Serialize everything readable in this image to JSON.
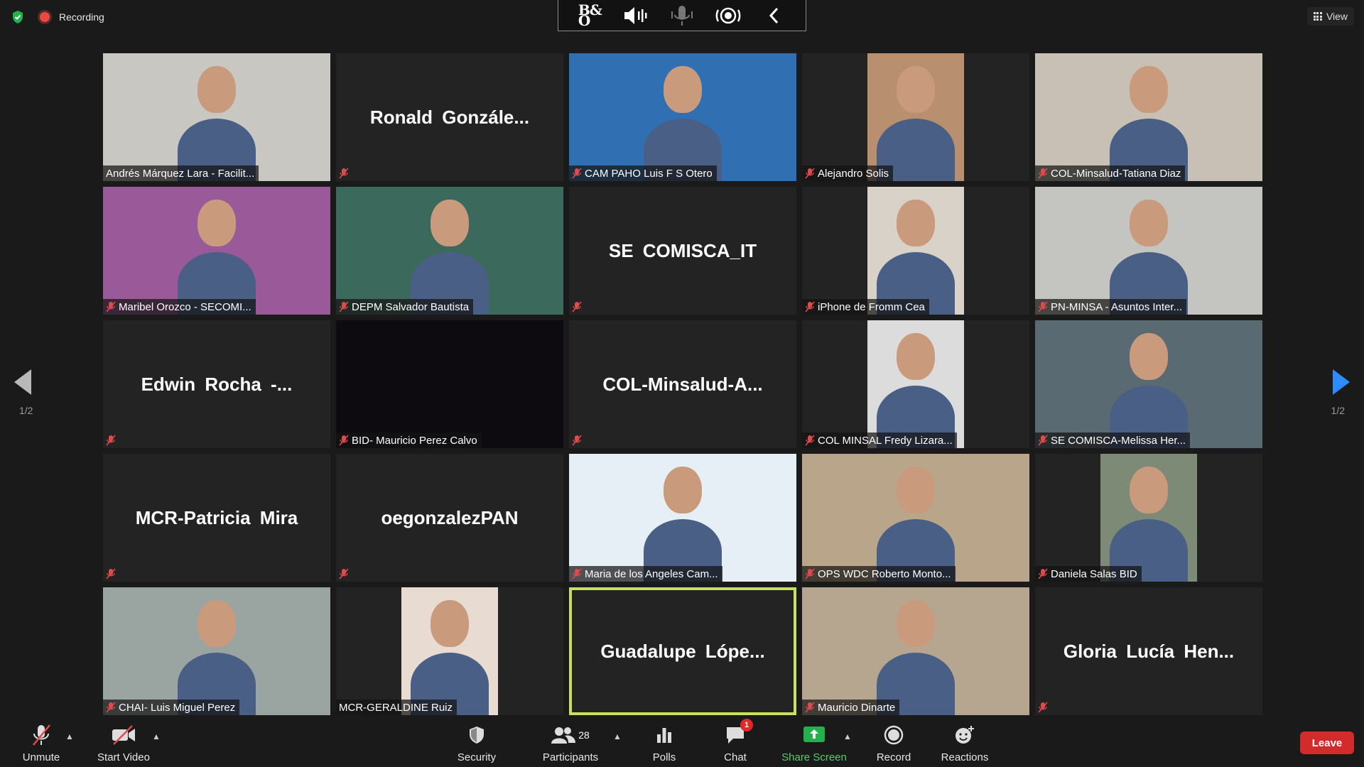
{
  "topbar": {
    "recording_label": "Recording",
    "view_label": "View"
  },
  "pager": {
    "left_page": "1/2",
    "right_page": "1/2"
  },
  "tiles": [
    {
      "name": "Andrés Márquez Lara - Facilit...",
      "mode": "video",
      "muted": false,
      "bg": "#c9c7c2"
    },
    {
      "name": "Ronald  Gonzále...",
      "mode": "text",
      "muted": true
    },
    {
      "name": "CAM PAHO Luis  F S Otero",
      "mode": "video",
      "muted": true,
      "bg": "#2f6fb2"
    },
    {
      "name": "Alejandro Solis",
      "mode": "narrow",
      "muted": true,
      "bg": "#b89070"
    },
    {
      "name": "COL-Minsalud-Tatiana Diaz",
      "mode": "video",
      "muted": true,
      "bg": "#c8c0b4"
    },
    {
      "name": "Maribel Orozco - SECOMI...",
      "mode": "video",
      "muted": true,
      "bg": "#9a5a9a"
    },
    {
      "name": "DEPM Salvador Bautista",
      "mode": "video",
      "muted": true,
      "bg": "#3b6a5c"
    },
    {
      "name": "SE COMISCA_IT",
      "mode": "text",
      "muted": true
    },
    {
      "name": "iPhone de Fromm Cea",
      "mode": "narrow",
      "muted": true,
      "bg": "#d9d2c8"
    },
    {
      "name": "PN-MINSA - Asuntos Inter...",
      "mode": "video",
      "muted": true,
      "bg": "#c4c4c0"
    },
    {
      "name": "Edwin  Rocha  -...",
      "mode": "text",
      "muted": true
    },
    {
      "name": "BID- Mauricio Perez Calvo",
      "mode": "dark",
      "muted": true
    },
    {
      "name": "COL-Minsalud-A...",
      "mode": "text",
      "muted": true
    },
    {
      "name": "COL MINSAL Fredy Lizara...",
      "mode": "narrow",
      "muted": true,
      "bg": "#dcdcdc"
    },
    {
      "name": "SE COMISCA-Melissa Her...",
      "mode": "video",
      "muted": true,
      "bg": "#5a6a72"
    },
    {
      "name": "MCR-Patricia Mira",
      "mode": "text",
      "muted": true
    },
    {
      "name": "oegonzalezPAN",
      "mode": "text",
      "muted": true
    },
    {
      "name": "Maria de los Angeles Cam...",
      "mode": "video",
      "muted": true,
      "bg": "#e6eef6"
    },
    {
      "name": "OPS WDC Roberto Monto...",
      "mode": "video",
      "muted": true,
      "bg": "#b9a68a"
    },
    {
      "name": "Daniela Salas BID",
      "mode": "narrow",
      "muted": true,
      "bg": "#7d8a76"
    },
    {
      "name": "CHAI- Luis Miguel Perez",
      "mode": "video",
      "muted": true,
      "bg": "#9aa4a0"
    },
    {
      "name": "MCR-GERALDINE Ruiz",
      "mode": "narrow",
      "muted": false,
      "bg": "#e8dcd2"
    },
    {
      "name": "Guadalupe  Lópe...",
      "mode": "text",
      "muted": false,
      "active": true
    },
    {
      "name": "Mauricio Dinarte",
      "mode": "video",
      "muted": true,
      "bg": "#b6a690"
    },
    {
      "name": "Gloria  Lucía  Hen...",
      "mode": "text",
      "muted": true
    }
  ],
  "toolbar": {
    "unmute_label": "Unmute",
    "start_video_label": "Start Video",
    "security_label": "Security",
    "participants_label": "Participants",
    "participants_count": "28",
    "polls_label": "Polls",
    "chat_label": "Chat",
    "chat_badge": "1",
    "share_screen_label": "Share Screen",
    "record_label": "Record",
    "reactions_label": "Reactions",
    "leave_label": "Leave"
  },
  "colors": {
    "background": "#1a1a1a",
    "tile": "#232323",
    "active_speaker": "#c8e05a",
    "share_green": "#22b14c",
    "leave_red": "#d12b2b",
    "muted_red": "#e04a4a",
    "page_arrow_blue": "#2d8cff"
  },
  "icons": {
    "shield": "shield-check-icon",
    "mic_off": "microphone-off-icon",
    "camera_off": "camera-off-icon",
    "security": "shield-icon",
    "participants": "people-icon",
    "polls": "bar-chart-icon",
    "chat": "chat-bubble-icon",
    "share": "share-screen-arrow-icon",
    "record": "record-circle-icon",
    "reactions": "smiley-plus-icon"
  }
}
